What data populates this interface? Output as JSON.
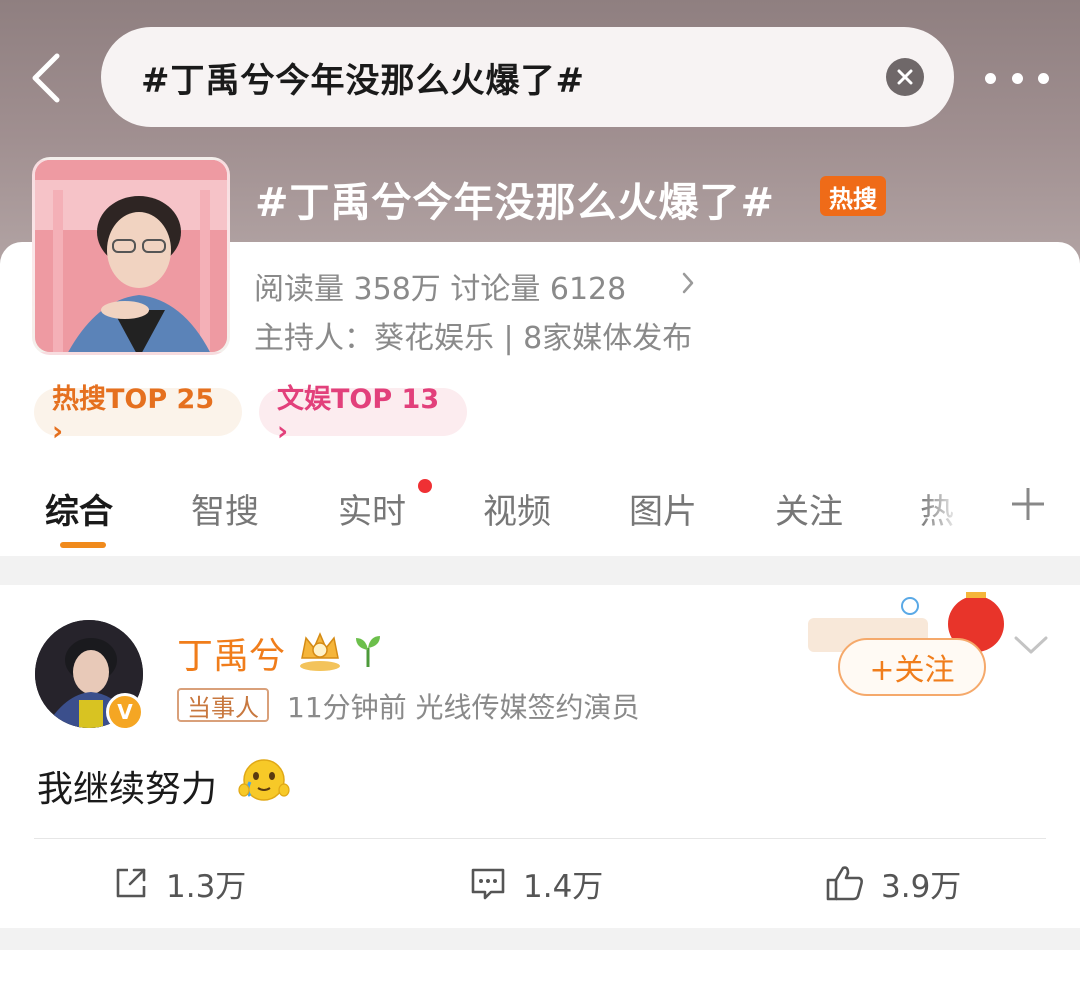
{
  "search": {
    "query": "#丁禹兮今年没那么火爆了#"
  },
  "topic": {
    "title": "#丁禹兮今年没那么火爆了#",
    "badge": "热搜",
    "stats": "阅读量 358万  讨论量 6128",
    "host": "主持人：葵花娱乐 | 8家媒体发布",
    "rank_hot": "热搜TOP 25 ›",
    "rank_ent": "文娱TOP 13 ›"
  },
  "tabs": [
    "综合",
    "智搜",
    "实时",
    "视频",
    "图片",
    "关注",
    "热"
  ],
  "post": {
    "username": "丁禹兮",
    "verify_mark": "V",
    "role_tag": "当事人",
    "meta": "11分钟前  光线传媒签约演员",
    "follow_label": "+关注",
    "text": "我继续努力",
    "repost_count": "1.3万",
    "comment_count": "1.4万",
    "like_count": "3.9万"
  },
  "icons": {
    "back": "chevron-left-icon",
    "clear": "clear-icon",
    "more": "more-icon",
    "plus": "plus-icon",
    "crown": "crown-icon",
    "sprout": "sprout-icon",
    "emoji": "emoji-icon",
    "repost": "repost-icon",
    "comment": "comment-icon",
    "like": "like-icon"
  },
  "colors": {
    "accent": "#f07d1b",
    "hot_badge": "#ef6b18",
    "ent_pink": "#e2407b",
    "red_dot": "#ef3034"
  }
}
